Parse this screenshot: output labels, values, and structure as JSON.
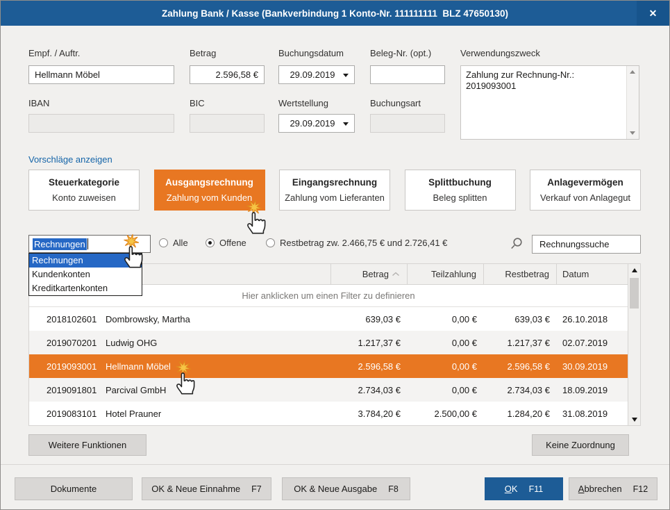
{
  "window": {
    "title": "Zahlung Bank / Kasse (Bankverbindung 1 Konto-Nr. 111111111  BLZ 47650130)",
    "close_icon": "✕"
  },
  "form": {
    "empf": {
      "label": "Empf. / Auftr.",
      "value": "Hellmann Möbel"
    },
    "betrag": {
      "label": "Betrag",
      "value": "2.596,58 €"
    },
    "buchungsdatum": {
      "label": "Buchungsdatum",
      "value": "29.09.2019"
    },
    "beleg": {
      "label": "Beleg-Nr. (opt.)",
      "value": ""
    },
    "verwendungszweck": {
      "label": "Verwendungszweck",
      "value": "Zahlung zur Rechnung-Nr.: 2019093001"
    },
    "iban": {
      "label": "IBAN",
      "value": ""
    },
    "bic": {
      "label": "BIC",
      "value": ""
    },
    "wertstellung": {
      "label": "Wertstellung",
      "value": "29.09.2019"
    },
    "buchungsart": {
      "label": "Buchungsart",
      "value": ""
    }
  },
  "suggestions_link": "Vorschläge anzeigen",
  "categories": [
    {
      "title": "Steuerkategorie",
      "subtitle": "Konto zuweisen",
      "active": false
    },
    {
      "title": "Ausgangsrechnung",
      "subtitle": "Zahlung vom Kunden",
      "active": true
    },
    {
      "title": "Eingangsrechnung",
      "subtitle": "Zahlung vom Lieferanten",
      "active": false
    },
    {
      "title": "Splittbuchung",
      "subtitle": "Beleg splitten",
      "active": false
    },
    {
      "title": "Anlagevermögen",
      "subtitle": "Verkauf von Anlagegut",
      "active": false
    }
  ],
  "filter": {
    "combo_value": "Rechnungen",
    "options": [
      "Rechnungen",
      "Kundenkonten",
      "Kreditkartenkonten"
    ],
    "radio_alle": "Alle",
    "radio_offene": "Offene",
    "radio_restbetrag": "Restbetrag zw. 2.466,75 € und 2.726,41 €",
    "selected_radio": "Offene",
    "search_value": "Rechnungssuche"
  },
  "table": {
    "headers": {
      "betrag": "Betrag",
      "teilzahlung": "Teilzahlung",
      "restbetrag": "Restbetrag",
      "datum": "Datum"
    },
    "sort_column": "Betrag",
    "sort_direction": "ascending",
    "filter_hint": "Hier anklicken um einen Filter zu definieren",
    "rows": [
      {
        "nr": "2018102601",
        "name": "Dombrowsky, Martha",
        "betrag": "639,03 €",
        "teilzahlung": "0,00 €",
        "restbetrag": "639,03 €",
        "datum": "26.10.2018",
        "selected": false
      },
      {
        "nr": "2019070201",
        "name": "Ludwig OHG",
        "betrag": "1.217,37 €",
        "teilzahlung": "0,00 €",
        "restbetrag": "1.217,37 €",
        "datum": "02.07.2019",
        "selected": false
      },
      {
        "nr": "2019093001",
        "name": "Hellmann Möbel",
        "betrag": "2.596,58 €",
        "teilzahlung": "0,00 €",
        "restbetrag": "2.596,58 €",
        "datum": "30.09.2019",
        "selected": true
      },
      {
        "nr": "2019091801",
        "name": "Parcival GmbH",
        "betrag": "2.734,03 €",
        "teilzahlung": "0,00 €",
        "restbetrag": "2.734,03 €",
        "datum": "18.09.2019",
        "selected": false
      },
      {
        "nr": "2019083101",
        "name": "Hotel Prauner",
        "betrag": "3.784,20 €",
        "teilzahlung": "2.500,00 €",
        "restbetrag": "1.284,20 €",
        "datum": "31.08.2019",
        "selected": false
      }
    ]
  },
  "actions": {
    "weitere_funktionen": "Weitere Funktionen",
    "keine_zuordnung": "Keine Zuordnung"
  },
  "footer": {
    "dokumente": "Dokumente",
    "ok_neue_einnahme": {
      "label": "OK & Neue Einnahme",
      "key": "F7"
    },
    "ok_neue_ausgabe": {
      "label": "OK & Neue Ausgabe",
      "key": "F8"
    },
    "ok": {
      "accel": "O",
      "rest": "K",
      "key": "F11"
    },
    "abbrechen": {
      "accel": "A",
      "rest": "bbrechen",
      "key": "F12"
    }
  },
  "colors": {
    "titlebar_blue": "#1d5c96",
    "accent_orange": "#e87722",
    "selection_blue": "#2668c5",
    "link_blue": "#1464a8"
  }
}
